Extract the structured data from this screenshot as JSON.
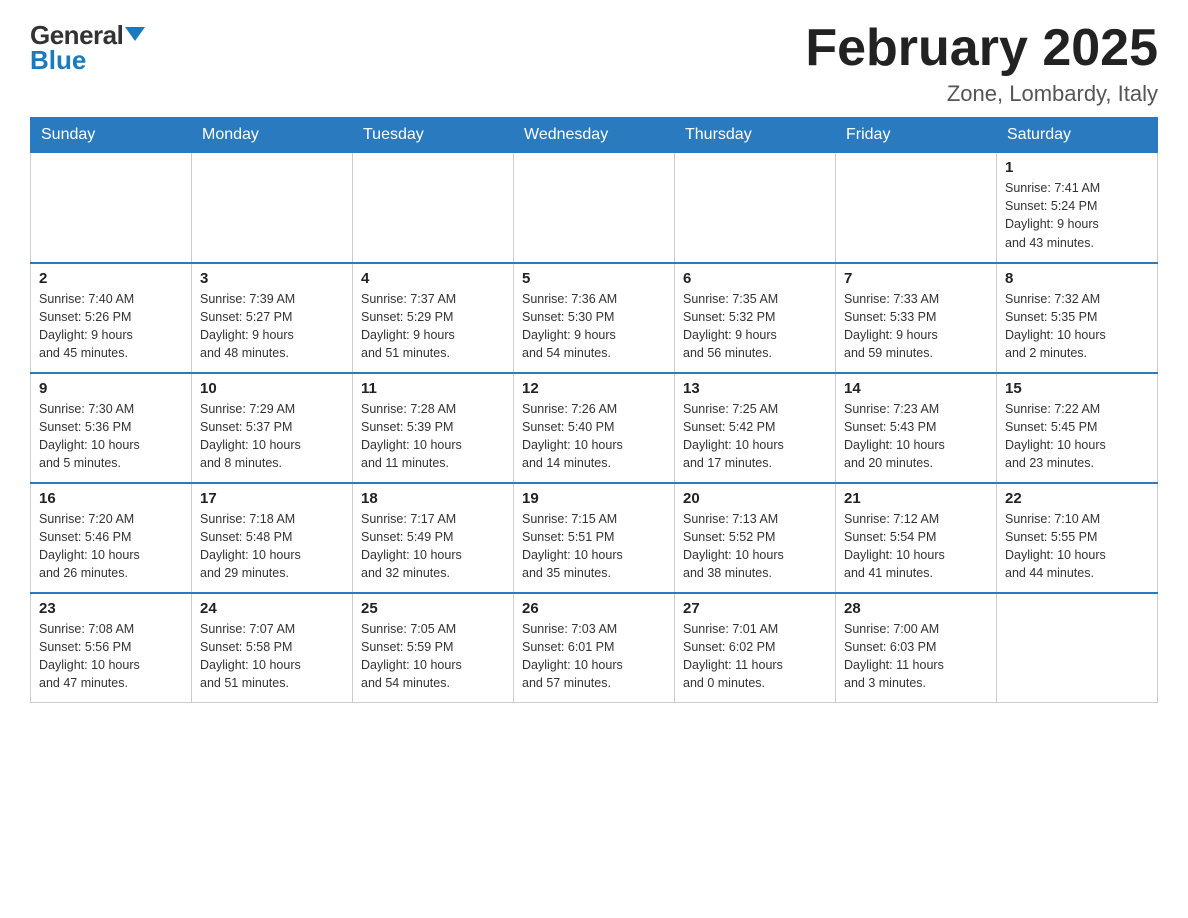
{
  "header": {
    "logo_general": "General",
    "logo_blue": "Blue",
    "month_year": "February 2025",
    "subtitle": "Zone, Lombardy, Italy"
  },
  "days_of_week": [
    "Sunday",
    "Monday",
    "Tuesday",
    "Wednesday",
    "Thursday",
    "Friday",
    "Saturday"
  ],
  "weeks": [
    [
      {
        "day": "",
        "info": ""
      },
      {
        "day": "",
        "info": ""
      },
      {
        "day": "",
        "info": ""
      },
      {
        "day": "",
        "info": ""
      },
      {
        "day": "",
        "info": ""
      },
      {
        "day": "",
        "info": ""
      },
      {
        "day": "1",
        "info": "Sunrise: 7:41 AM\nSunset: 5:24 PM\nDaylight: 9 hours\nand 43 minutes."
      }
    ],
    [
      {
        "day": "2",
        "info": "Sunrise: 7:40 AM\nSunset: 5:26 PM\nDaylight: 9 hours\nand 45 minutes."
      },
      {
        "day": "3",
        "info": "Sunrise: 7:39 AM\nSunset: 5:27 PM\nDaylight: 9 hours\nand 48 minutes."
      },
      {
        "day": "4",
        "info": "Sunrise: 7:37 AM\nSunset: 5:29 PM\nDaylight: 9 hours\nand 51 minutes."
      },
      {
        "day": "5",
        "info": "Sunrise: 7:36 AM\nSunset: 5:30 PM\nDaylight: 9 hours\nand 54 minutes."
      },
      {
        "day": "6",
        "info": "Sunrise: 7:35 AM\nSunset: 5:32 PM\nDaylight: 9 hours\nand 56 minutes."
      },
      {
        "day": "7",
        "info": "Sunrise: 7:33 AM\nSunset: 5:33 PM\nDaylight: 9 hours\nand 59 minutes."
      },
      {
        "day": "8",
        "info": "Sunrise: 7:32 AM\nSunset: 5:35 PM\nDaylight: 10 hours\nand 2 minutes."
      }
    ],
    [
      {
        "day": "9",
        "info": "Sunrise: 7:30 AM\nSunset: 5:36 PM\nDaylight: 10 hours\nand 5 minutes."
      },
      {
        "day": "10",
        "info": "Sunrise: 7:29 AM\nSunset: 5:37 PM\nDaylight: 10 hours\nand 8 minutes."
      },
      {
        "day": "11",
        "info": "Sunrise: 7:28 AM\nSunset: 5:39 PM\nDaylight: 10 hours\nand 11 minutes."
      },
      {
        "day": "12",
        "info": "Sunrise: 7:26 AM\nSunset: 5:40 PM\nDaylight: 10 hours\nand 14 minutes."
      },
      {
        "day": "13",
        "info": "Sunrise: 7:25 AM\nSunset: 5:42 PM\nDaylight: 10 hours\nand 17 minutes."
      },
      {
        "day": "14",
        "info": "Sunrise: 7:23 AM\nSunset: 5:43 PM\nDaylight: 10 hours\nand 20 minutes."
      },
      {
        "day": "15",
        "info": "Sunrise: 7:22 AM\nSunset: 5:45 PM\nDaylight: 10 hours\nand 23 minutes."
      }
    ],
    [
      {
        "day": "16",
        "info": "Sunrise: 7:20 AM\nSunset: 5:46 PM\nDaylight: 10 hours\nand 26 minutes."
      },
      {
        "day": "17",
        "info": "Sunrise: 7:18 AM\nSunset: 5:48 PM\nDaylight: 10 hours\nand 29 minutes."
      },
      {
        "day": "18",
        "info": "Sunrise: 7:17 AM\nSunset: 5:49 PM\nDaylight: 10 hours\nand 32 minutes."
      },
      {
        "day": "19",
        "info": "Sunrise: 7:15 AM\nSunset: 5:51 PM\nDaylight: 10 hours\nand 35 minutes."
      },
      {
        "day": "20",
        "info": "Sunrise: 7:13 AM\nSunset: 5:52 PM\nDaylight: 10 hours\nand 38 minutes."
      },
      {
        "day": "21",
        "info": "Sunrise: 7:12 AM\nSunset: 5:54 PM\nDaylight: 10 hours\nand 41 minutes."
      },
      {
        "day": "22",
        "info": "Sunrise: 7:10 AM\nSunset: 5:55 PM\nDaylight: 10 hours\nand 44 minutes."
      }
    ],
    [
      {
        "day": "23",
        "info": "Sunrise: 7:08 AM\nSunset: 5:56 PM\nDaylight: 10 hours\nand 47 minutes."
      },
      {
        "day": "24",
        "info": "Sunrise: 7:07 AM\nSunset: 5:58 PM\nDaylight: 10 hours\nand 51 minutes."
      },
      {
        "day": "25",
        "info": "Sunrise: 7:05 AM\nSunset: 5:59 PM\nDaylight: 10 hours\nand 54 minutes."
      },
      {
        "day": "26",
        "info": "Sunrise: 7:03 AM\nSunset: 6:01 PM\nDaylight: 10 hours\nand 57 minutes."
      },
      {
        "day": "27",
        "info": "Sunrise: 7:01 AM\nSunset: 6:02 PM\nDaylight: 11 hours\nand 0 minutes."
      },
      {
        "day": "28",
        "info": "Sunrise: 7:00 AM\nSunset: 6:03 PM\nDaylight: 11 hours\nand 3 minutes."
      },
      {
        "day": "",
        "info": ""
      }
    ]
  ]
}
